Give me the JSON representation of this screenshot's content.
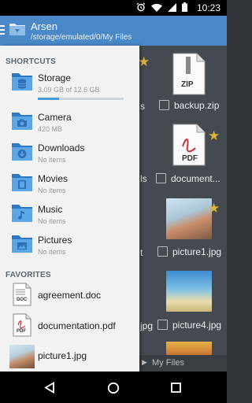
{
  "status_bar": {
    "time": "10:23",
    "icons": [
      "alarm-icon",
      "wifi-icon",
      "cell-signal-icon",
      "battery-icon"
    ]
  },
  "app_bar": {
    "title": "Arsen",
    "path": "/storage/emulated/0/My Files"
  },
  "drawer": {
    "shortcuts_header": "SHORTCUTS",
    "shortcuts": [
      {
        "label": "Storage",
        "sub": "3.09 GB of 12.6 GB",
        "icon": "storage-folder-icon",
        "usage_fraction": 0.25
      },
      {
        "label": "Camera",
        "sub": "420 MB",
        "icon": "camera-folder-icon"
      },
      {
        "label": "Downloads",
        "sub": "No items",
        "icon": "downloads-folder-icon"
      },
      {
        "label": "Movies",
        "sub": "No items",
        "icon": "movies-folder-icon"
      },
      {
        "label": "Music",
        "sub": "No items",
        "icon": "music-folder-icon"
      },
      {
        "label": "Pictures",
        "sub": "No items",
        "icon": "pictures-folder-icon"
      }
    ],
    "favorites_header": "FAVORITES",
    "favorites": [
      {
        "label": "agreement.doc",
        "icon_text": "DOC"
      },
      {
        "label": "documentation.pdf",
        "icon_text": "PDF"
      },
      {
        "label": "picture1.jpg"
      }
    ]
  },
  "background": {
    "files": [
      {
        "name": "backup.zip",
        "icon_text": "ZIP"
      },
      {
        "name": "document...",
        "icon_text": "PDF"
      },
      {
        "name": "picture1.jpg"
      },
      {
        "name": "picture4.jpg"
      }
    ],
    "partial_labels": [
      "s",
      "ls",
      "t",
      "jpg"
    ],
    "bottom_path": "My Files"
  },
  "colors": {
    "accent": "#4a88c7",
    "star": "#d8b43a",
    "drawer_bg": "#f2f2f2"
  }
}
